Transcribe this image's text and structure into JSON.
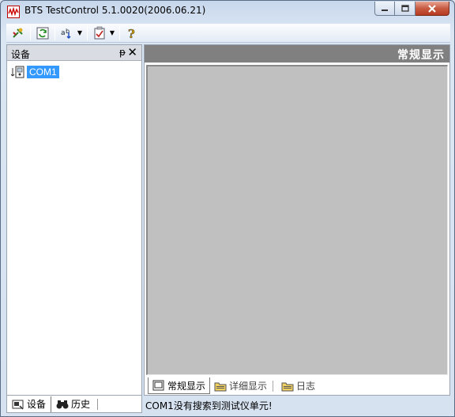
{
  "window": {
    "title": "BTS TestControl 5.1.0020(2006.06.21)"
  },
  "toolbar": {
    "buttons": [
      {
        "icon": "connect-icon"
      },
      {
        "icon": "refresh-icon"
      },
      {
        "icon": "find-icon"
      },
      {
        "icon": "checklist-icon"
      },
      {
        "icon": "help-icon"
      }
    ]
  },
  "left_panel": {
    "title": "设备",
    "pin_glyph": "ᵽ",
    "close_glyph": "✕",
    "tree": [
      {
        "label": "COM1",
        "icon": "device-icon",
        "selected": true
      }
    ],
    "tabs": [
      {
        "label": "设备",
        "icon": "device-tab-icon",
        "active": true
      },
      {
        "label": "历史",
        "icon": "binoculars-icon",
        "active": false
      }
    ]
  },
  "right_panel": {
    "title": "常规显示",
    "tabs": [
      {
        "label": "常规显示",
        "icon": "display-icon",
        "active": true
      },
      {
        "label": "详细显示",
        "icon": "folder-icon",
        "active": false
      },
      {
        "label": "日志",
        "icon": "folder-icon",
        "active": false
      }
    ]
  },
  "status": {
    "text": "COM1没有搜索到测试仪单元!"
  }
}
